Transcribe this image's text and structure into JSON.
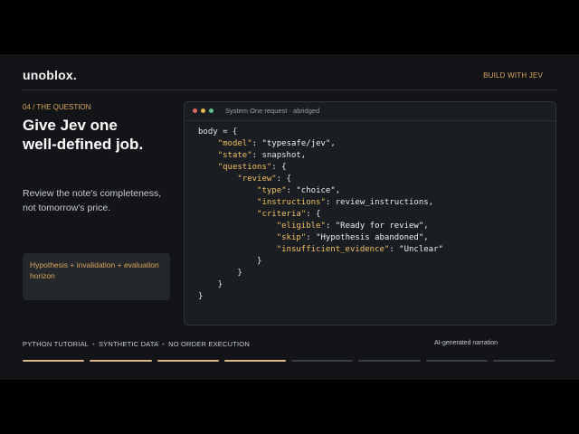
{
  "brand": "unoblox.",
  "tag": "BUILD WITH JEV",
  "section": "04 / THE QUESTION",
  "heading": [
    "Give Jev one",
    "well-defined job."
  ],
  "body": [
    "Review the note's completeness,",
    "not tomorrow's price."
  ],
  "callout": "Hypothesis + invalidation + evaluation horizon",
  "code": {
    "title": "System One request · abridged",
    "lines": [
      [
        [
          "p",
          "body = {"
        ]
      ],
      [
        [
          "p",
          "    "
        ],
        [
          "k",
          "\"model\""
        ],
        [
          "p",
          ": "
        ],
        [
          "s",
          "\"typesafe/jev\""
        ],
        [
          "p",
          ","
        ]
      ],
      [
        [
          "p",
          "    "
        ],
        [
          "k",
          "\"state\""
        ],
        [
          "p",
          ": snapshot,"
        ]
      ],
      [
        [
          "p",
          "    "
        ],
        [
          "k",
          "\"questions\""
        ],
        [
          "p",
          ": {"
        ]
      ],
      [
        [
          "p",
          "        "
        ],
        [
          "k",
          "\"review\""
        ],
        [
          "p",
          ": {"
        ]
      ],
      [
        [
          "p",
          "            "
        ],
        [
          "k",
          "\"type\""
        ],
        [
          "p",
          ": "
        ],
        [
          "s",
          "\"choice\""
        ],
        [
          "p",
          ","
        ]
      ],
      [
        [
          "p",
          "            "
        ],
        [
          "k",
          "\"instructions\""
        ],
        [
          "p",
          ": review_instructions,"
        ]
      ],
      [
        [
          "p",
          "            "
        ],
        [
          "k",
          "\"criteria\""
        ],
        [
          "p",
          ": {"
        ]
      ],
      [
        [
          "p",
          "                "
        ],
        [
          "k",
          "\"eligible\""
        ],
        [
          "p",
          ": "
        ],
        [
          "s",
          "\"Ready for review\""
        ],
        [
          "p",
          ","
        ]
      ],
      [
        [
          "p",
          "                "
        ],
        [
          "k",
          "\"skip\""
        ],
        [
          "p",
          ": "
        ],
        [
          "s",
          "\"Hypothesis abandoned\""
        ],
        [
          "p",
          ","
        ]
      ],
      [
        [
          "p",
          "                "
        ],
        [
          "k",
          "\"insufficient_evidence\""
        ],
        [
          "p",
          ": "
        ],
        [
          "s",
          "\"Unclear\""
        ]
      ],
      [
        [
          "p",
          "            }"
        ]
      ],
      [
        [
          "p",
          "        }"
        ]
      ],
      [
        [
          "p",
          "    }"
        ]
      ],
      [
        [
          "p",
          "}"
        ]
      ]
    ]
  },
  "footer": {
    "items": [
      "PYTHON TUTORIAL",
      "SYNTHETIC DATA",
      "NO ORDER EXECUTION"
    ],
    "separator": "•",
    "right": "AI-generated narration"
  },
  "progress": {
    "total": 8,
    "completed": 4
  },
  "colors": {
    "accent": "#d9a65a",
    "background": "#121418",
    "panel": "#1a1d22"
  }
}
